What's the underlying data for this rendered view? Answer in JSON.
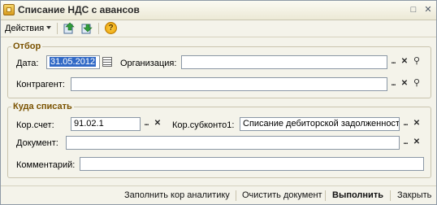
{
  "window": {
    "title": "Списание НДС с авансов"
  },
  "toolbar": {
    "actions_label": "Действия",
    "help_label": "?"
  },
  "otbor": {
    "legend": "Отбор",
    "date_label": "Дата:",
    "date_value": "31.05.2012",
    "org_label": "Организация:",
    "org_value": "",
    "kontragent_label": "Контрагент:",
    "kontragent_value": ""
  },
  "kuda": {
    "legend": "Куда списать",
    "korschet_label": "Кор.счет:",
    "korschet_value": "91.02.1",
    "korsubkonto_label": "Кор.субконто1:",
    "korsubkonto_value": "Списание дебиторской задолженности",
    "document_label": "Документ:",
    "document_value": "",
    "comment_label": "Комментарий:",
    "comment_value": ""
  },
  "footer": {
    "fill_label": "Заполнить кор аналитику",
    "clear_label": "Очистить документ",
    "run_label": "Выполнить",
    "close_label": "Закрыть"
  }
}
